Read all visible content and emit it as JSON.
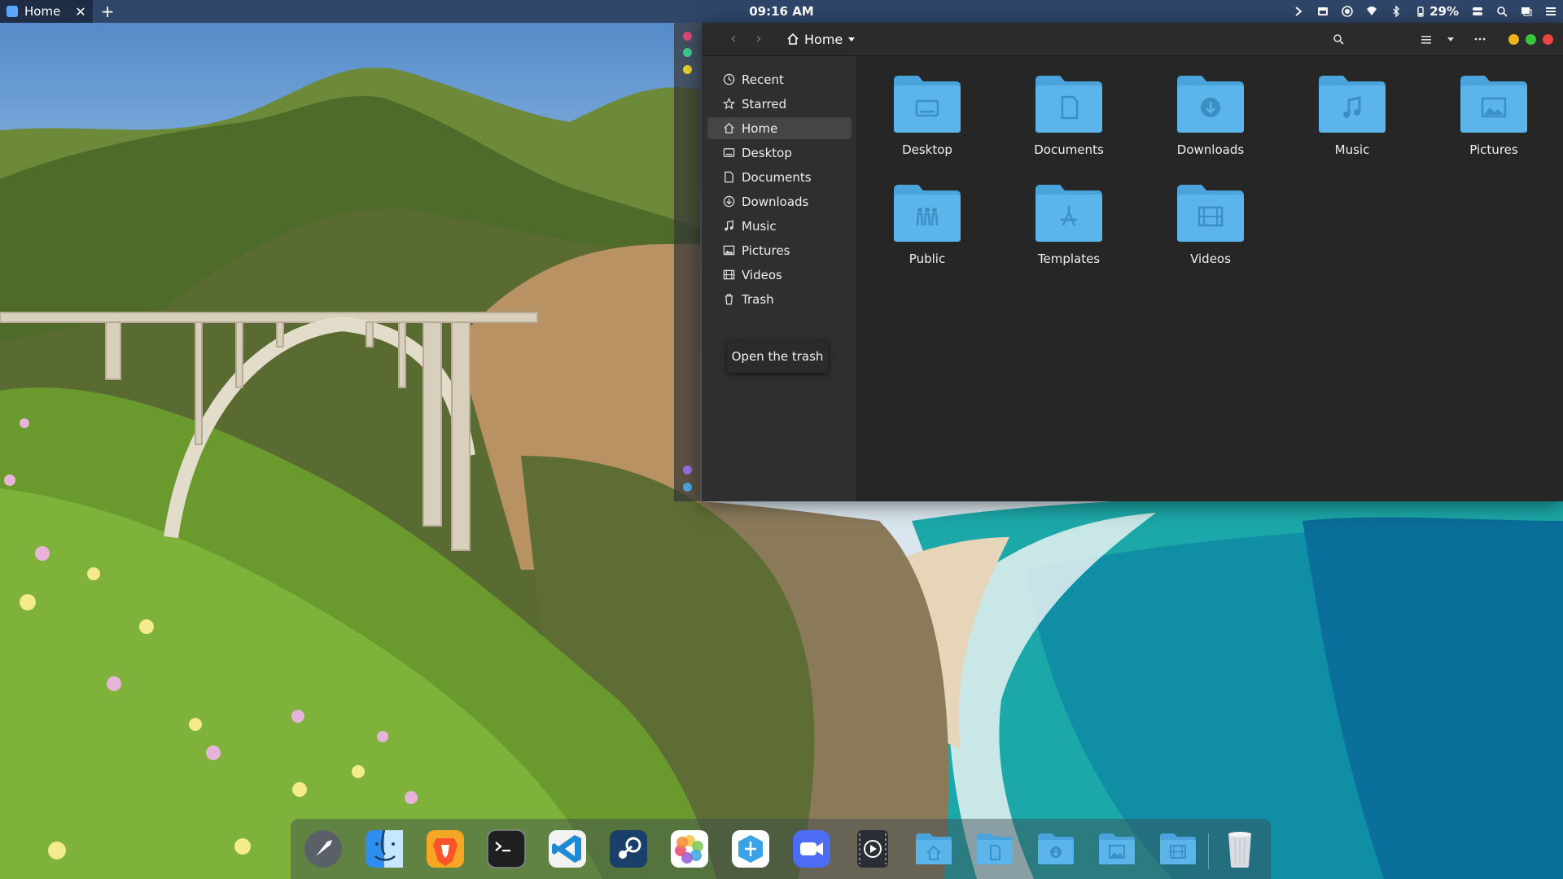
{
  "topbar": {
    "tab_title": "Home",
    "clock": "09:16 AM",
    "battery": "29%",
    "icons": [
      "tab-close-icon",
      "new-tab-icon",
      "chevron-right-icon",
      "window-icon",
      "record-icon",
      "wifi-icon",
      "bluetooth-icon",
      "battery-icon",
      "toggle-icon",
      "search-icon",
      "screen-icon",
      "menu-icon"
    ]
  },
  "file_manager": {
    "location": "Home",
    "sidebar": [
      {
        "label": "Recent",
        "icon": "clock-icon"
      },
      {
        "label": "Starred",
        "icon": "star-icon"
      },
      {
        "label": "Home",
        "icon": "home-icon",
        "active": true
      },
      {
        "label": "Desktop",
        "icon": "desktop-icon"
      },
      {
        "label": "Documents",
        "icon": "document-icon"
      },
      {
        "label": "Downloads",
        "icon": "download-icon"
      },
      {
        "label": "Music",
        "icon": "music-icon"
      },
      {
        "label": "Pictures",
        "icon": "picture-icon"
      },
      {
        "label": "Videos",
        "icon": "video-icon"
      },
      {
        "label": "Trash",
        "icon": "trash-icon"
      }
    ],
    "tooltip": "Open the trash",
    "folders": [
      {
        "label": "Desktop",
        "icon": "desktop-icon"
      },
      {
        "label": "Documents",
        "icon": "document-icon"
      },
      {
        "label": "Downloads",
        "icon": "download-icon"
      },
      {
        "label": "Music",
        "icon": "music-icon"
      },
      {
        "label": "Pictures",
        "icon": "picture-icon"
      },
      {
        "label": "Public",
        "icon": "people-icon"
      },
      {
        "label": "Templates",
        "icon": "templates-icon"
      },
      {
        "label": "Videos",
        "icon": "video-icon"
      }
    ],
    "colors": {
      "folder": "#5bb4ea",
      "close": "#ee4444",
      "minimize": "#f0b31e",
      "maximize": "#3cc43c"
    }
  },
  "dock": {
    "apps": [
      "launchpad-icon",
      "finder-icon",
      "brave-browser-icon",
      "terminal-icon",
      "vscode-icon",
      "steam-icon",
      "photos-icon",
      "app-store-icon",
      "zoom-icon",
      "video-player-icon",
      "home-folder-icon",
      "documents-folder-icon",
      "downloads-folder-icon",
      "pictures-folder-icon",
      "videos-folder-icon",
      "trash-icon"
    ]
  }
}
